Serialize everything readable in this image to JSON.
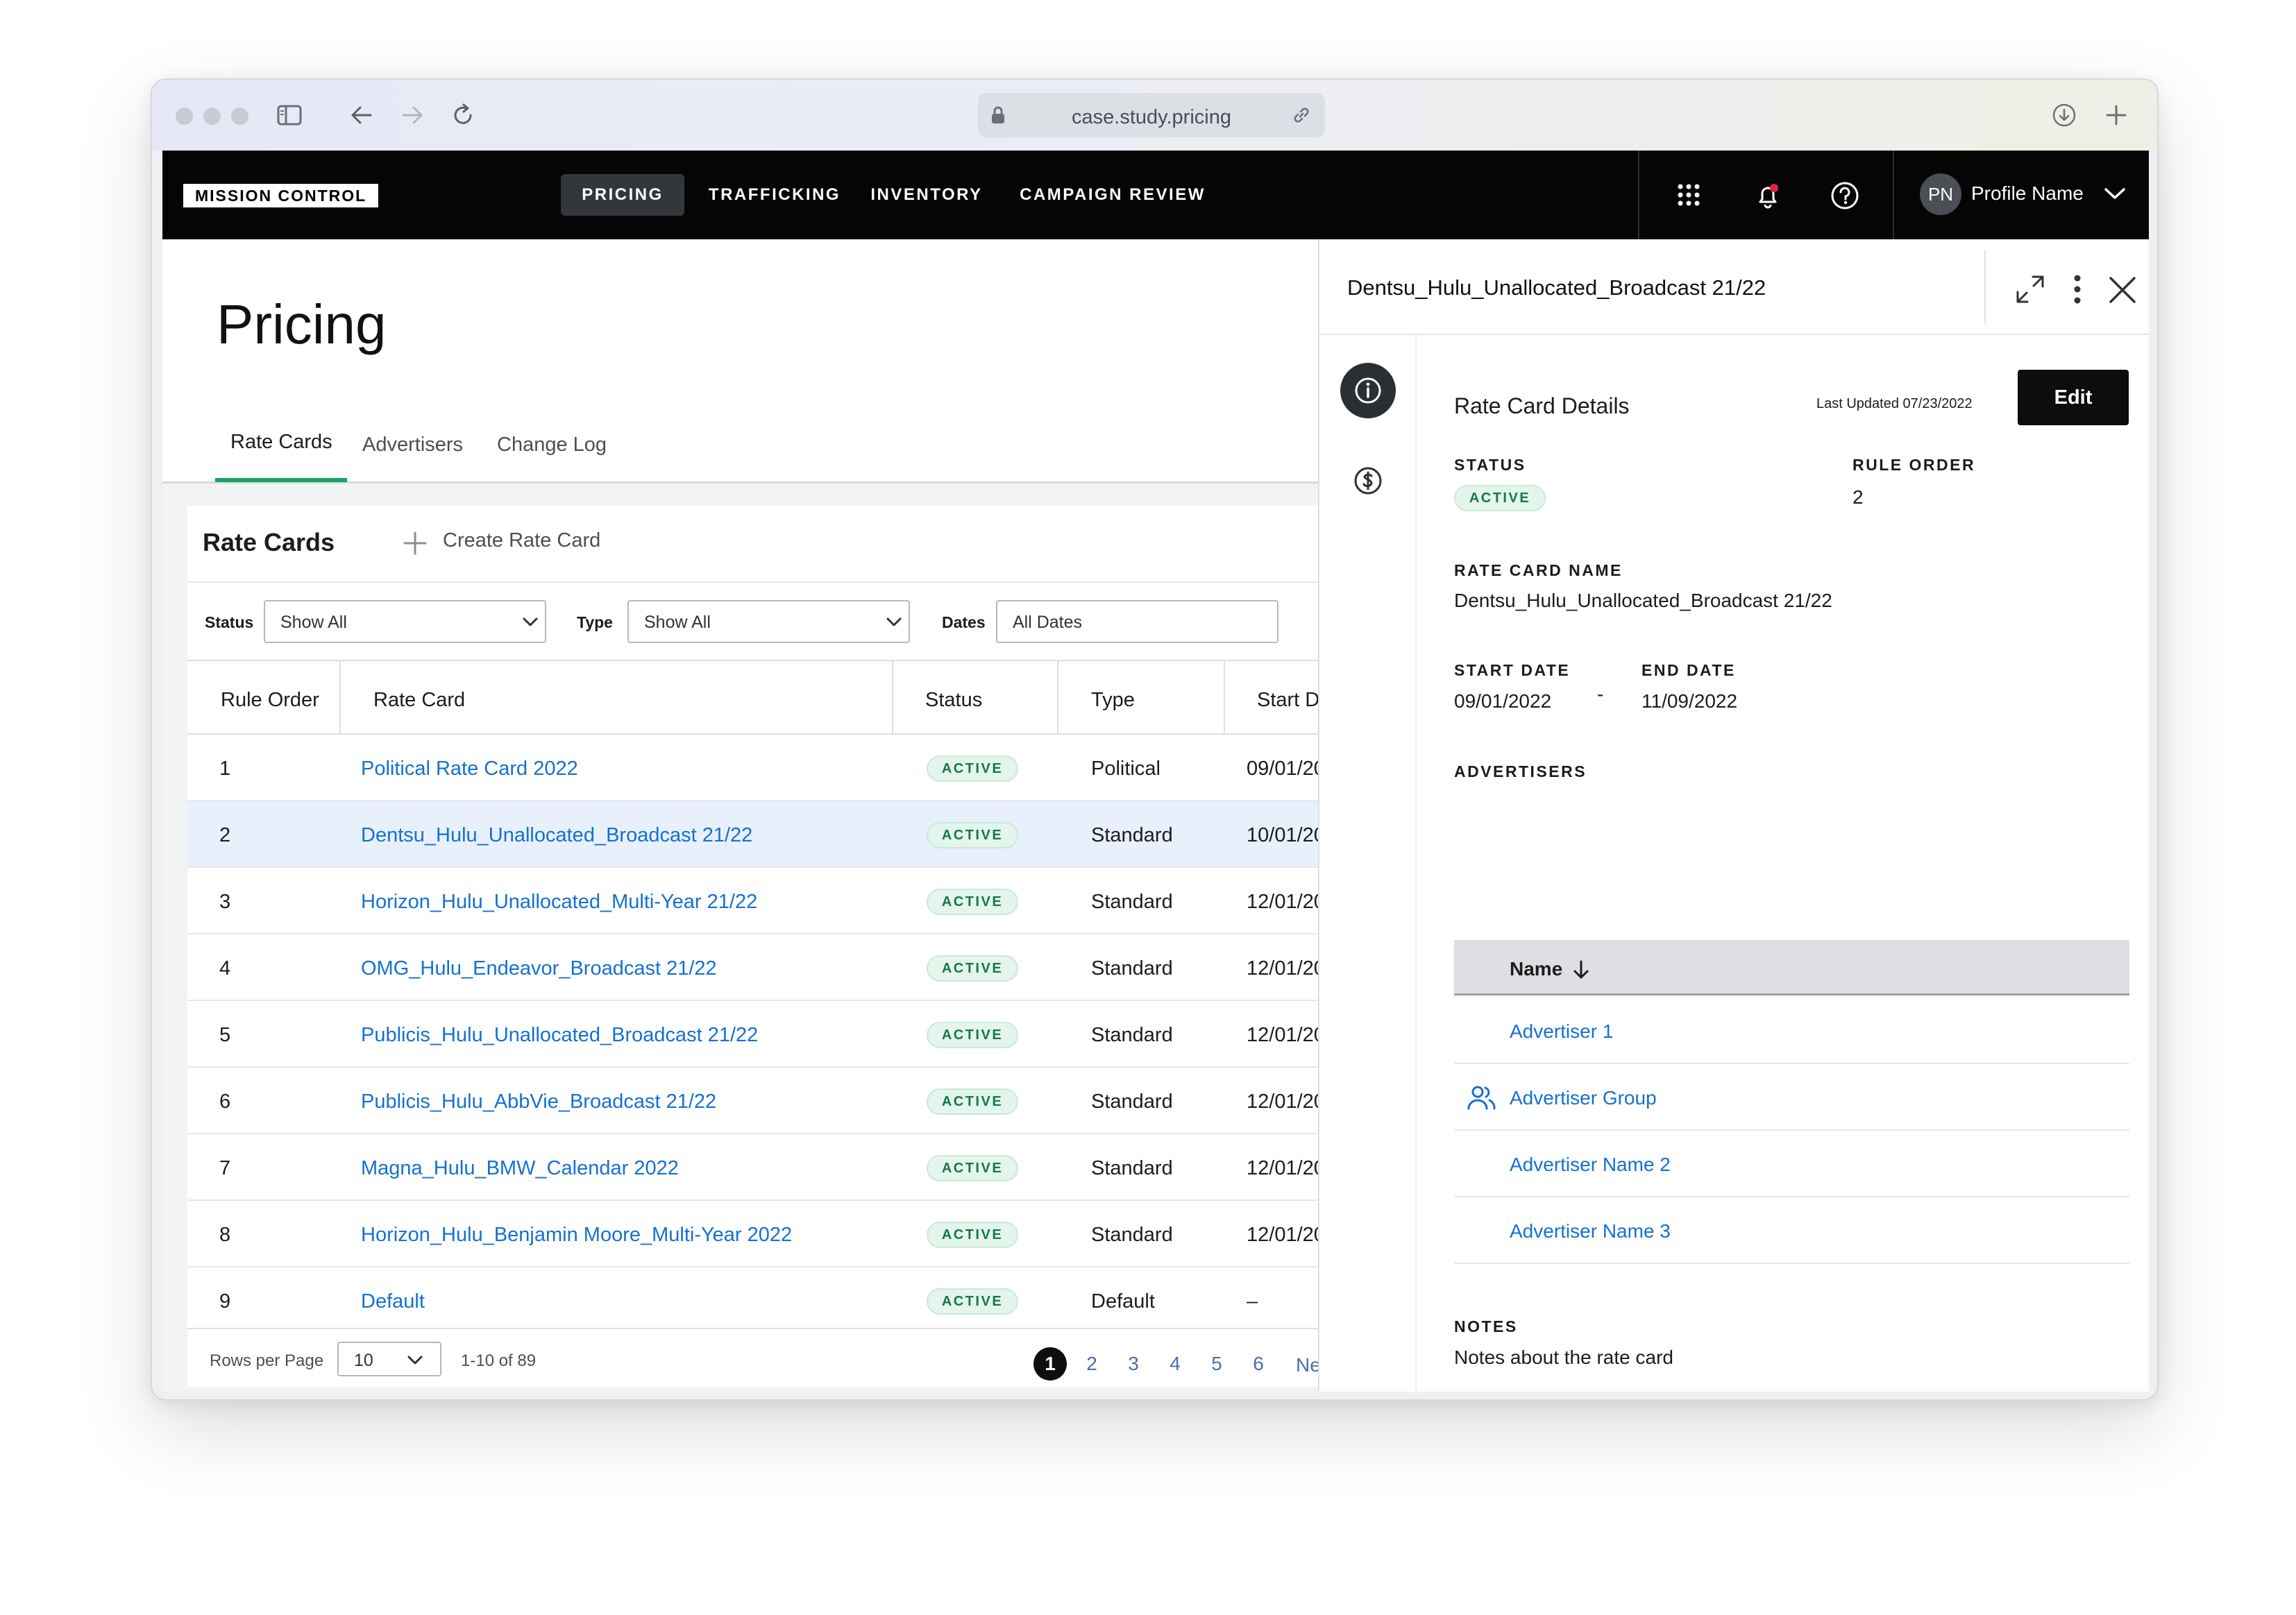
{
  "browser": {
    "url": "case.study.pricing"
  },
  "nav": {
    "logo": "MISSION CONTROL",
    "items": [
      {
        "label": "PRICING",
        "active": true
      },
      {
        "label": "TRAFFICKING",
        "active": false
      },
      {
        "label": "INVENTORY",
        "active": false
      },
      {
        "label": "CAMPAIGN REVIEW",
        "active": false
      }
    ],
    "avatar_initials": "PN",
    "profile_name": "Profile Name",
    "notification_dot_color": "#e0244f"
  },
  "page": {
    "title": "Pricing",
    "tabs": [
      {
        "label": "Rate Cards",
        "active": true
      },
      {
        "label": "Advertisers",
        "active": false
      },
      {
        "label": "Change Log",
        "active": false
      }
    ]
  },
  "rate_cards": {
    "heading": "Rate Cards",
    "create_label": "Create Rate Card",
    "filters": {
      "status_label": "Status",
      "status_value": "Show All",
      "type_label": "Type",
      "type_value": "Show All",
      "dates_label": "Dates",
      "dates_value": "All Dates"
    },
    "columns": [
      "Rule Order",
      "Rate Card",
      "Status",
      "Type",
      "Start D"
    ],
    "rows": [
      {
        "order": "1",
        "name": "Political Rate Card 2022",
        "status": "ACTIVE",
        "type": "Political",
        "start": "09/01/20"
      },
      {
        "order": "2",
        "name": "Dentsu_Hulu_Unallocated_Broadcast 21/22",
        "status": "ACTIVE",
        "type": "Standard",
        "start": "10/01/20",
        "selected": true
      },
      {
        "order": "3",
        "name": "Horizon_Hulu_Unallocated_Multi-Year 21/22",
        "status": "ACTIVE",
        "type": "Standard",
        "start": "12/01/20"
      },
      {
        "order": "4",
        "name": "OMG_Hulu_Endeavor_Broadcast 21/22",
        "status": "ACTIVE",
        "type": "Standard",
        "start": "12/01/20"
      },
      {
        "order": "5",
        "name": "Publicis_Hulu_Unallocated_Broadcast 21/22",
        "status": "ACTIVE",
        "type": "Standard",
        "start": "12/01/20"
      },
      {
        "order": "6",
        "name": "Publicis_Hulu_AbbVie_Broadcast 21/22",
        "status": "ACTIVE",
        "type": "Standard",
        "start": "12/01/20"
      },
      {
        "order": "7",
        "name": "Magna_Hulu_BMW_Calendar 2022",
        "status": "ACTIVE",
        "type": "Standard",
        "start": "12/01/20"
      },
      {
        "order": "8",
        "name": "Horizon_Hulu_Benjamin Moore_Multi-Year 2022",
        "status": "ACTIVE",
        "type": "Standard",
        "start": "12/01/20"
      },
      {
        "order": "9",
        "name": "Default",
        "status": "ACTIVE",
        "type": "Default",
        "start": "–"
      }
    ],
    "footer": {
      "rows_per_page_label": "Rows per Page",
      "rows_per_page_value": "10",
      "range": "1-10 of 89",
      "pages": [
        "1",
        "2",
        "3",
        "4",
        "5",
        "6"
      ],
      "current_page": "1",
      "next_label": "Ne"
    }
  },
  "panel": {
    "title": "Dentsu_Hulu_Unallocated_Broadcast 21/22",
    "section_title": "Rate Card Details",
    "last_updated": "Last Updated 07/23/2022",
    "edit_label": "Edit",
    "status_label": "STATUS",
    "status_value": "ACTIVE",
    "rule_order_label": "RULE ORDER",
    "rule_order_value": "2",
    "name_label": "RATE CARD NAME",
    "name_value": "Dentsu_Hulu_Unallocated_Broadcast 21/22",
    "start_label": "START DATE",
    "start_value": "09/01/2022",
    "date_separator": "-",
    "end_label": "END DATE",
    "end_value": "11/09/2022",
    "advertisers_label": "ADVERTISERS",
    "advertisers_col": "Name",
    "advertisers": [
      {
        "name": "Advertiser 1",
        "group": false
      },
      {
        "name": "Advertiser Group",
        "group": true
      },
      {
        "name": "Advertiser Name 2",
        "group": false
      },
      {
        "name": "Advertiser Name 3",
        "group": false
      }
    ],
    "notes_label": "NOTES",
    "notes_value": "Notes about the rate card"
  },
  "colors": {
    "link": "#1470d4",
    "active_tab": "#1aa364",
    "badge_bg": "#e3f5ec",
    "badge_text": "#137a48",
    "selected_row": "#e8f0fc"
  }
}
